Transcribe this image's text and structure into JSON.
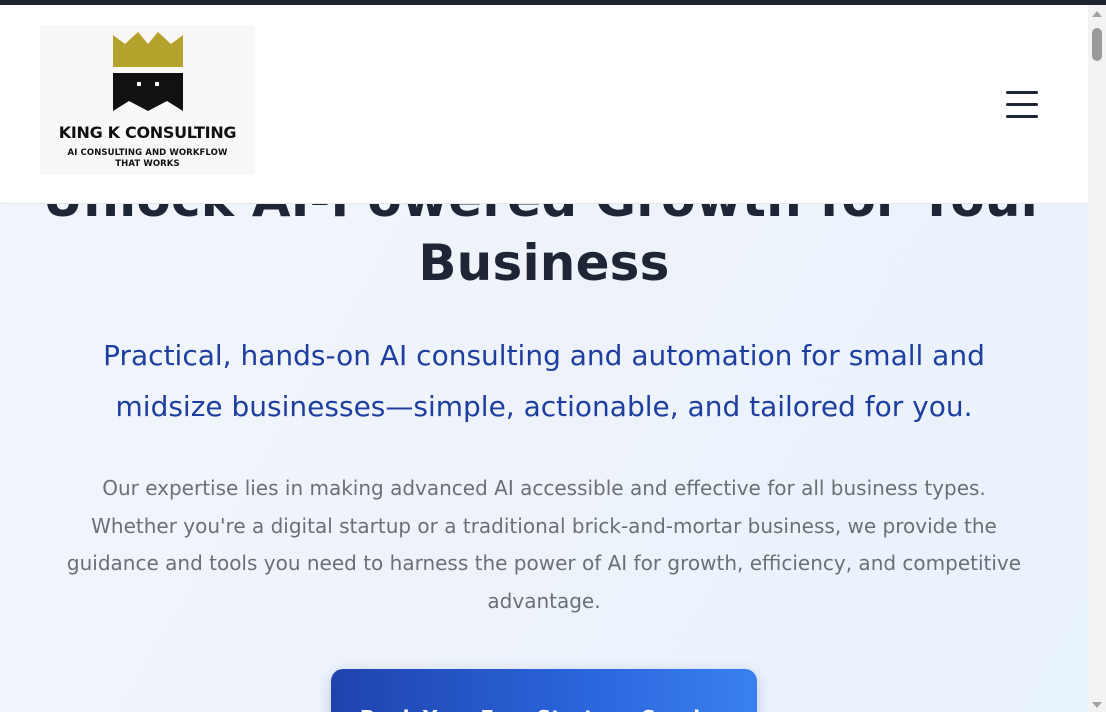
{
  "header": {
    "logo": {
      "name": "KING K CONSULTING",
      "tagline_line1": "AI CONSULTING AND WORKFLOW",
      "tagline_line2": "THAT WORKS",
      "crown_color": "#b5a22c",
      "mark_color": "#111111"
    },
    "menu_icon": "hamburger-icon"
  },
  "hero": {
    "title_line1": "Unlock AI-Powered Growth for Your",
    "title_line2": "Business",
    "subtitle_line1": "Practical, hands-on AI consulting and automation for small and",
    "subtitle_line2": "midsize businesses—simple, actionable, and tailored for you.",
    "body_line1": "Our expertise lies in making advanced AI accessible and effective for all business types.",
    "body_line2": "Whether you're a digital startup or a traditional brick-and-mortar business, we provide the",
    "body_line3": "guidance and tools you need to harness the power of AI for growth, efficiency, and competitive",
    "body_line4": "advantage.",
    "cta_label": "Book Your Free Strategy Session"
  },
  "colors": {
    "title": "#1e2535",
    "subtitle": "#1f3fa0",
    "body": "#6b7076",
    "cta_gradient_start": "#1f43ad",
    "cta_gradient_end": "#3a80f0"
  }
}
